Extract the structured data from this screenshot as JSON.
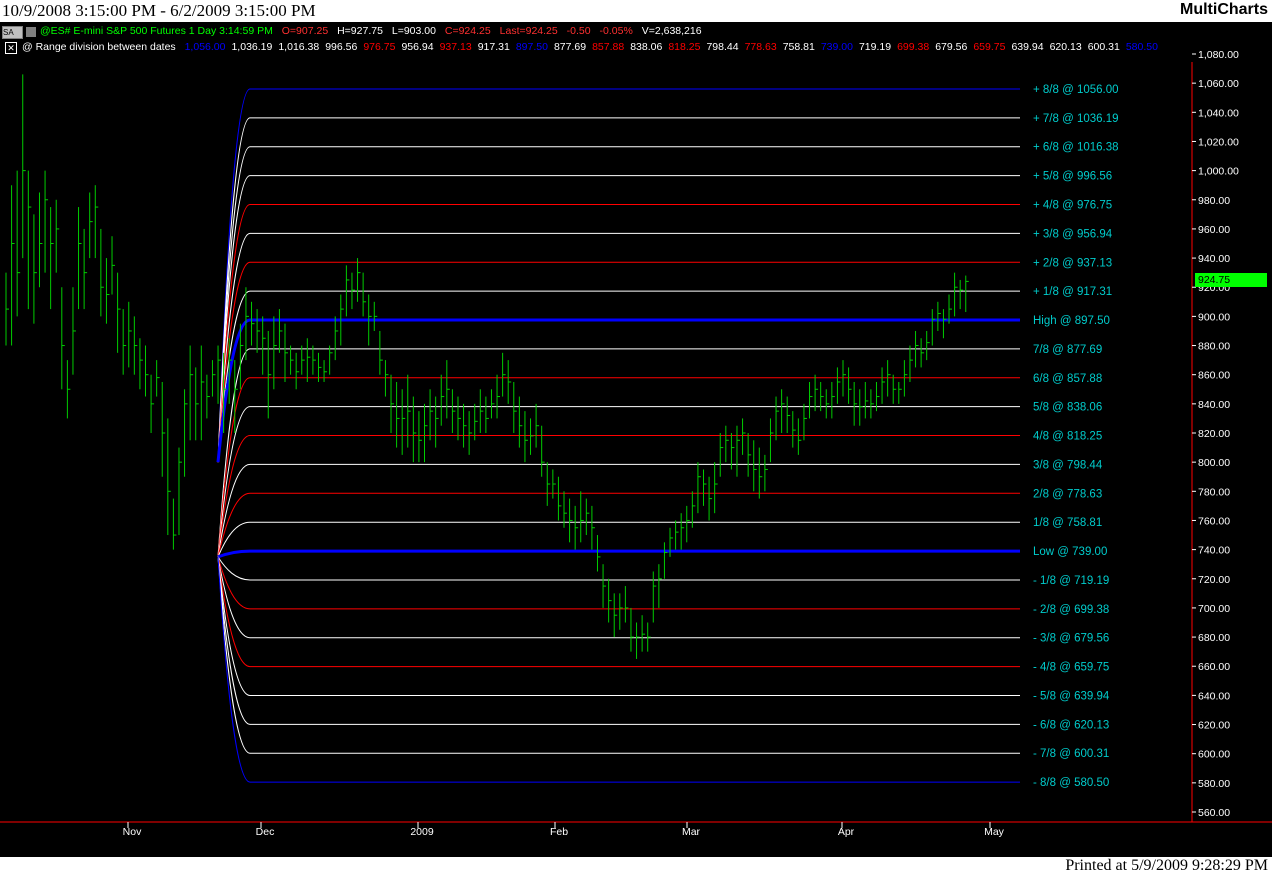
{
  "window": {
    "date_range": "10/9/2008 3:15:00 PM - 6/2/2009 3:15:00 PM",
    "app_name": "MultiCharts",
    "printed": "Printed at 5/9/2009 9:28:29 PM"
  },
  "header": {
    "symbol_box": "SA",
    "instrument": "@ES# E-mini S&P 500 Futures 1 Day 3:14:59 PM",
    "open": "O=907.25",
    "high": "H=927.75",
    "low": "L=903.00",
    "close": "C=924.25",
    "last": "Last=924.25",
    "change": "-0.50",
    "change_pct": "-0.05%",
    "volume": "V=2,638,216"
  },
  "study": {
    "name": "@ Range division between dates",
    "values": [
      {
        "text": "1,056.00",
        "color": "#0000ff"
      },
      {
        "text": "1,036.19",
        "color": "#ffffff"
      },
      {
        "text": "1,016.38",
        "color": "#ffffff"
      },
      {
        "text": "996.56",
        "color": "#ffffff"
      },
      {
        "text": "976.75",
        "color": "#ff0000"
      },
      {
        "text": "956.94",
        "color": "#ffffff"
      },
      {
        "text": "937.13",
        "color": "#ff0000"
      },
      {
        "text": "917.31",
        "color": "#ffffff"
      },
      {
        "text": "897.50",
        "color": "#0000ff"
      },
      {
        "text": "877.69",
        "color": "#ffffff"
      },
      {
        "text": "857.88",
        "color": "#ff0000"
      },
      {
        "text": "838.06",
        "color": "#ffffff"
      },
      {
        "text": "818.25",
        "color": "#ff0000"
      },
      {
        "text": "798.44",
        "color": "#ffffff"
      },
      {
        "text": "778.63",
        "color": "#ff0000"
      },
      {
        "text": "758.81",
        "color": "#ffffff"
      },
      {
        "text": "739.00",
        "color": "#0000ff"
      },
      {
        "text": "719.19",
        "color": "#ffffff"
      },
      {
        "text": "699.38",
        "color": "#ff0000"
      },
      {
        "text": "679.56",
        "color": "#ffffff"
      },
      {
        "text": "659.75",
        "color": "#ff0000"
      },
      {
        "text": "639.94",
        "color": "#ffffff"
      },
      {
        "text": "620.13",
        "color": "#ffffff"
      },
      {
        "text": "600.31",
        "color": "#ffffff"
      },
      {
        "text": "580.50",
        "color": "#0000ff"
      }
    ]
  },
  "colors": {
    "background": "#000000",
    "bars": "#00cc00",
    "border": "#ff0000",
    "labels": "#00cccc",
    "last_price_tag": "#00ff00"
  },
  "chart_data": {
    "type": "ohlc_bar",
    "y_axis": {
      "min": 560,
      "max": 1080,
      "ticks": [
        "1,080.00",
        "1,060.00",
        "1,040.00",
        "1,020.00",
        "1,000.00",
        "980.00",
        "960.00",
        "940.00",
        "920.00",
        "900.00",
        "880.00",
        "860.00",
        "840.00",
        "820.00",
        "800.00",
        "780.00",
        "760.00",
        "740.00",
        "720.00",
        "700.00",
        "680.00",
        "660.00",
        "640.00",
        "620.00",
        "600.00",
        "580.00",
        "560.00"
      ],
      "tick_values": [
        1080,
        1060,
        1040,
        1020,
        1000,
        980,
        960,
        940,
        920,
        900,
        880,
        860,
        840,
        820,
        800,
        780,
        760,
        740,
        720,
        700,
        680,
        660,
        640,
        620,
        600,
        580,
        560
      ]
    },
    "x_axis": {
      "labels": [
        "Nov",
        "Dec",
        "2009",
        "Feb",
        "Mar",
        "Apr",
        "May"
      ]
    },
    "last_price": {
      "text": "924.75",
      "value": 924.75
    },
    "levels": [
      {
        "label": "+ 8/8 @ 1056.00",
        "value": 1056.0,
        "color": "#0000ff",
        "bold": false
      },
      {
        "label": "+ 7/8 @ 1036.19",
        "value": 1036.19,
        "color": "#ffffff",
        "bold": false
      },
      {
        "label": "+ 6/8 @ 1016.38",
        "value": 1016.38,
        "color": "#ffffff",
        "bold": false
      },
      {
        "label": "+ 5/8 @ 996.56",
        "value": 996.56,
        "color": "#ffffff",
        "bold": false
      },
      {
        "label": "+ 4/8 @ 976.75",
        "value": 976.75,
        "color": "#ff0000",
        "bold": false
      },
      {
        "label": "+ 3/8 @ 956.94",
        "value": 956.94,
        "color": "#ffffff",
        "bold": false
      },
      {
        "label": "+ 2/8 @ 937.13",
        "value": 937.13,
        "color": "#ff0000",
        "bold": false
      },
      {
        "label": "+ 1/8 @ 917.31",
        "value": 917.31,
        "color": "#ffffff",
        "bold": false
      },
      {
        "label": "High @ 897.50",
        "value": 897.5,
        "color": "#0000ff",
        "bold": true
      },
      {
        "label": "7/8 @ 877.69",
        "value": 877.69,
        "color": "#ffffff",
        "bold": false
      },
      {
        "label": "6/8 @ 857.88",
        "value": 857.88,
        "color": "#ff0000",
        "bold": false
      },
      {
        "label": "5/8 @ 838.06",
        "value": 838.06,
        "color": "#ffffff",
        "bold": false
      },
      {
        "label": "4/8 @ 818.25",
        "value": 818.25,
        "color": "#ff0000",
        "bold": false
      },
      {
        "label": "3/8 @ 798.44",
        "value": 798.44,
        "color": "#ffffff",
        "bold": false
      },
      {
        "label": "2/8 @ 778.63",
        "value": 778.63,
        "color": "#ff0000",
        "bold": false
      },
      {
        "label": "1/8 @ 758.81",
        "value": 758.81,
        "color": "#ffffff",
        "bold": false
      },
      {
        "label": "Low  @ 739.00",
        "value": 739.0,
        "color": "#0000ff",
        "bold": true
      },
      {
        "label": "- 1/8 @ 719.19",
        "value": 719.19,
        "color": "#ffffff",
        "bold": false
      },
      {
        "label": "- 2/8 @ 699.38",
        "value": 699.38,
        "color": "#ff0000",
        "bold": false
      },
      {
        "label": "- 3/8 @ 679.56",
        "value": 679.56,
        "color": "#ffffff",
        "bold": false
      },
      {
        "label": "- 4/8 @ 659.75",
        "value": 659.75,
        "color": "#ff0000",
        "bold": false
      },
      {
        "label": "- 5/8 @ 639.94",
        "value": 639.94,
        "color": "#ffffff",
        "bold": false
      },
      {
        "label": "- 6/8 @ 620.13",
        "value": 620.13,
        "color": "#ffffff",
        "bold": false
      },
      {
        "label": "- 7/8 @ 600.31",
        "value": 600.31,
        "color": "#ffffff",
        "bold": false
      },
      {
        "label": "- 8/8 @ 580.50",
        "value": 580.5,
        "color": "#0000ff",
        "bold": false
      }
    ],
    "bars": [
      {
        "h": 930,
        "l": 880,
        "c": 905
      },
      {
        "h": 990,
        "l": 880,
        "c": 950
      },
      {
        "h": 1000,
        "l": 900,
        "c": 930
      },
      {
        "h": 1066,
        "l": 940,
        "c": 1000
      },
      {
        "h": 1000,
        "l": 905,
        "c": 975
      },
      {
        "h": 970,
        "l": 895,
        "c": 930
      },
      {
        "h": 985,
        "l": 920,
        "c": 950
      },
      {
        "h": 1000,
        "l": 930,
        "c": 980
      },
      {
        "h": 975,
        "l": 905,
        "c": 950
      },
      {
        "h": 980,
        "l": 930,
        "c": 960
      },
      {
        "h": 920,
        "l": 850,
        "c": 880
      },
      {
        "h": 870,
        "l": 830,
        "c": 850
      },
      {
        "h": 920,
        "l": 860,
        "c": 890
      },
      {
        "h": 975,
        "l": 905,
        "c": 950
      },
      {
        "h": 960,
        "l": 905,
        "c": 930
      },
      {
        "h": 985,
        "l": 940,
        "c": 965
      },
      {
        "h": 990,
        "l": 940,
        "c": 975
      },
      {
        "h": 960,
        "l": 900,
        "c": 920
      },
      {
        "h": 940,
        "l": 895,
        "c": 915
      },
      {
        "h": 955,
        "l": 915,
        "c": 935
      },
      {
        "h": 930,
        "l": 875,
        "c": 905
      },
      {
        "h": 905,
        "l": 860,
        "c": 880
      },
      {
        "h": 910,
        "l": 865,
        "c": 890
      },
      {
        "h": 900,
        "l": 860,
        "c": 880
      },
      {
        "h": 885,
        "l": 850,
        "c": 870
      },
      {
        "h": 880,
        "l": 845,
        "c": 860
      },
      {
        "h": 860,
        "l": 820,
        "c": 840
      },
      {
        "h": 870,
        "l": 845,
        "c": 858
      },
      {
        "h": 855,
        "l": 790,
        "c": 820
      },
      {
        "h": 830,
        "l": 750,
        "c": 780
      },
      {
        "h": 775,
        "l": 740,
        "c": 750
      },
      {
        "h": 810,
        "l": 750,
        "c": 800
      },
      {
        "h": 850,
        "l": 790,
        "c": 840
      },
      {
        "h": 880,
        "l": 815,
        "c": 860
      },
      {
        "h": 865,
        "l": 815,
        "c": 840
      },
      {
        "h": 880,
        "l": 815,
        "c": 855
      },
      {
        "h": 860,
        "l": 830,
        "c": 845
      },
      {
        "h": 870,
        "l": 845,
        "c": 860
      },
      {
        "h": 880,
        "l": 840,
        "c": 870
      },
      {
        "h": 875,
        "l": 820,
        "c": 850
      },
      {
        "h": 885,
        "l": 840,
        "c": 870
      },
      {
        "h": 870,
        "l": 820,
        "c": 850
      },
      {
        "h": 895,
        "l": 850,
        "c": 880
      },
      {
        "h": 920,
        "l": 870,
        "c": 900
      },
      {
        "h": 910,
        "l": 880,
        "c": 895
      },
      {
        "h": 905,
        "l": 875,
        "c": 890
      },
      {
        "h": 900,
        "l": 860,
        "c": 885
      },
      {
        "h": 890,
        "l": 830,
        "c": 860
      },
      {
        "h": 900,
        "l": 850,
        "c": 880
      },
      {
        "h": 905,
        "l": 875,
        "c": 890
      },
      {
        "h": 895,
        "l": 855,
        "c": 875
      },
      {
        "h": 880,
        "l": 860,
        "c": 870
      },
      {
        "h": 875,
        "l": 850,
        "c": 862
      },
      {
        "h": 880,
        "l": 860,
        "c": 870
      },
      {
        "h": 885,
        "l": 855,
        "c": 872
      },
      {
        "h": 880,
        "l": 860,
        "c": 870
      },
      {
        "h": 875,
        "l": 855,
        "c": 865
      },
      {
        "h": 870,
        "l": 855,
        "c": 862
      },
      {
        "h": 880,
        "l": 860,
        "c": 875
      },
      {
        "h": 900,
        "l": 870,
        "c": 890
      },
      {
        "h": 915,
        "l": 880,
        "c": 905
      },
      {
        "h": 935,
        "l": 900,
        "c": 925
      },
      {
        "h": 930,
        "l": 905,
        "c": 918
      },
      {
        "h": 940,
        "l": 910,
        "c": 930
      },
      {
        "h": 930,
        "l": 900,
        "c": 910
      },
      {
        "h": 915,
        "l": 880,
        "c": 900
      },
      {
        "h": 910,
        "l": 890,
        "c": 900
      },
      {
        "h": 890,
        "l": 860,
        "c": 870
      },
      {
        "h": 870,
        "l": 845,
        "c": 860
      },
      {
        "h": 860,
        "l": 820,
        "c": 840
      },
      {
        "h": 855,
        "l": 810,
        "c": 830
      },
      {
        "h": 850,
        "l": 805,
        "c": 830
      },
      {
        "h": 860,
        "l": 810,
        "c": 835
      },
      {
        "h": 845,
        "l": 800,
        "c": 820
      },
      {
        "h": 835,
        "l": 800,
        "c": 815
      },
      {
        "h": 840,
        "l": 800,
        "c": 825
      },
      {
        "h": 850,
        "l": 815,
        "c": 835
      },
      {
        "h": 845,
        "l": 810,
        "c": 830
      },
      {
        "h": 860,
        "l": 825,
        "c": 845
      },
      {
        "h": 870,
        "l": 830,
        "c": 850
      },
      {
        "h": 850,
        "l": 820,
        "c": 835
      },
      {
        "h": 845,
        "l": 815,
        "c": 830
      },
      {
        "h": 840,
        "l": 810,
        "c": 825
      },
      {
        "h": 835,
        "l": 805,
        "c": 820
      },
      {
        "h": 840,
        "l": 815,
        "c": 828
      },
      {
        "h": 850,
        "l": 820,
        "c": 835
      },
      {
        "h": 845,
        "l": 820,
        "c": 830
      },
      {
        "h": 850,
        "l": 830,
        "c": 840
      },
      {
        "h": 860,
        "l": 830,
        "c": 845
      },
      {
        "h": 875,
        "l": 845,
        "c": 860
      },
      {
        "h": 870,
        "l": 840,
        "c": 855
      },
      {
        "h": 855,
        "l": 820,
        "c": 835
      },
      {
        "h": 845,
        "l": 810,
        "c": 825
      },
      {
        "h": 835,
        "l": 800,
        "c": 815
      },
      {
        "h": 830,
        "l": 805,
        "c": 818
      },
      {
        "h": 840,
        "l": 810,
        "c": 825
      },
      {
        "h": 825,
        "l": 790,
        "c": 800
      },
      {
        "h": 800,
        "l": 770,
        "c": 785
      },
      {
        "h": 795,
        "l": 775,
        "c": 785
      },
      {
        "h": 790,
        "l": 760,
        "c": 770
      },
      {
        "h": 780,
        "l": 755,
        "c": 765
      },
      {
        "h": 775,
        "l": 745,
        "c": 760
      },
      {
        "h": 770,
        "l": 740,
        "c": 755
      },
      {
        "h": 780,
        "l": 745,
        "c": 760
      },
      {
        "h": 775,
        "l": 750,
        "c": 765
      },
      {
        "h": 770,
        "l": 740,
        "c": 755
      },
      {
        "h": 750,
        "l": 725,
        "c": 735
      },
      {
        "h": 730,
        "l": 700,
        "c": 715
      },
      {
        "h": 720,
        "l": 690,
        "c": 705
      },
      {
        "h": 710,
        "l": 680,
        "c": 695
      },
      {
        "h": 710,
        "l": 685,
        "c": 700
      },
      {
        "h": 715,
        "l": 690,
        "c": 700
      },
      {
        "h": 700,
        "l": 670,
        "c": 680
      },
      {
        "h": 690,
        "l": 665,
        "c": 680
      },
      {
        "h": 695,
        "l": 670,
        "c": 682
      },
      {
        "h": 690,
        "l": 670,
        "c": 680
      },
      {
        "h": 725,
        "l": 690,
        "c": 715
      },
      {
        "h": 730,
        "l": 700,
        "c": 720
      },
      {
        "h": 745,
        "l": 720,
        "c": 738
      },
      {
        "h": 755,
        "l": 735,
        "c": 748
      },
      {
        "h": 760,
        "l": 740,
        "c": 752
      },
      {
        "h": 765,
        "l": 740,
        "c": 755
      },
      {
        "h": 770,
        "l": 745,
        "c": 760
      },
      {
        "h": 780,
        "l": 755,
        "c": 770
      },
      {
        "h": 800,
        "l": 765,
        "c": 790
      },
      {
        "h": 795,
        "l": 770,
        "c": 785
      },
      {
        "h": 790,
        "l": 760,
        "c": 775
      },
      {
        "h": 800,
        "l": 765,
        "c": 785
      },
      {
        "h": 820,
        "l": 790,
        "c": 810
      },
      {
        "h": 825,
        "l": 800,
        "c": 815
      },
      {
        "h": 820,
        "l": 795,
        "c": 810
      },
      {
        "h": 825,
        "l": 790,
        "c": 815
      },
      {
        "h": 830,
        "l": 805,
        "c": 820
      },
      {
        "h": 820,
        "l": 790,
        "c": 805
      },
      {
        "h": 815,
        "l": 780,
        "c": 795
      },
      {
        "h": 810,
        "l": 775,
        "c": 790
      },
      {
        "h": 805,
        "l": 780,
        "c": 795
      },
      {
        "h": 830,
        "l": 800,
        "c": 820
      },
      {
        "h": 845,
        "l": 815,
        "c": 835
      },
      {
        "h": 850,
        "l": 820,
        "c": 840
      },
      {
        "h": 845,
        "l": 820,
        "c": 832
      },
      {
        "h": 835,
        "l": 810,
        "c": 822
      },
      {
        "h": 830,
        "l": 805,
        "c": 815
      },
      {
        "h": 840,
        "l": 815,
        "c": 830
      },
      {
        "h": 855,
        "l": 830,
        "c": 845
      },
      {
        "h": 860,
        "l": 835,
        "c": 850
      },
      {
        "h": 855,
        "l": 835,
        "c": 845
      },
      {
        "h": 850,
        "l": 830,
        "c": 840
      },
      {
        "h": 855,
        "l": 830,
        "c": 845
      },
      {
        "h": 865,
        "l": 840,
        "c": 855
      },
      {
        "h": 870,
        "l": 845,
        "c": 860
      },
      {
        "h": 865,
        "l": 840,
        "c": 850
      },
      {
        "h": 855,
        "l": 825,
        "c": 840
      },
      {
        "h": 850,
        "l": 825,
        "c": 838
      },
      {
        "h": 855,
        "l": 830,
        "c": 842
      },
      {
        "h": 850,
        "l": 830,
        "c": 840
      },
      {
        "h": 855,
        "l": 835,
        "c": 845
      },
      {
        "h": 865,
        "l": 840,
        "c": 855
      },
      {
        "h": 870,
        "l": 845,
        "c": 860
      },
      {
        "h": 860,
        "l": 840,
        "c": 850
      },
      {
        "h": 855,
        "l": 840,
        "c": 850
      },
      {
        "h": 870,
        "l": 845,
        "c": 860
      },
      {
        "h": 880,
        "l": 855,
        "c": 870
      },
      {
        "h": 890,
        "l": 865,
        "c": 880
      },
      {
        "h": 885,
        "l": 865,
        "c": 875
      },
      {
        "h": 890,
        "l": 870,
        "c": 882
      },
      {
        "h": 905,
        "l": 880,
        "c": 898
      },
      {
        "h": 910,
        "l": 890,
        "c": 902
      },
      {
        "h": 905,
        "l": 885,
        "c": 898
      },
      {
        "h": 915,
        "l": 895,
        "c": 905
      },
      {
        "h": 930,
        "l": 900,
        "c": 920
      },
      {
        "h": 925,
        "l": 905,
        "c": 918
      },
      {
        "h": 928,
        "l": 903,
        "c": 924
      }
    ]
  }
}
